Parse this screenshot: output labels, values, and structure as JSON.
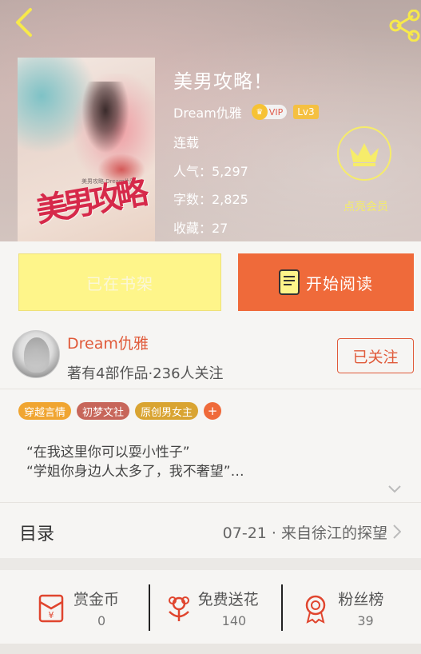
{
  "book": {
    "title": "美男攻略！",
    "author": "Dream仇雅",
    "vip_label": "VIP",
    "level": "Lv3",
    "status": "连载",
    "popularity": "人气：5,297",
    "word_count": "字数：2,825",
    "collections": "收藏：27",
    "cover_title": "美男攻略",
    "cover_subtitle": "美男攻略·Dream仇雅"
  },
  "vip_member": {
    "label": "点亮会员"
  },
  "actions": {
    "shelf_label": "已在书架",
    "read_label": "开始阅读"
  },
  "author_info": {
    "name": "Dream仇雅",
    "stats": "著有4部作品·236人关注",
    "follow_label": "已关注"
  },
  "tags": [
    {
      "label": "穿越言情",
      "color": "#f0a531"
    },
    {
      "label": "初梦文社",
      "color": "#c7665a"
    },
    {
      "label": "原创男女主",
      "color": "#d9a432"
    }
  ],
  "tag_add": "+",
  "description": {
    "line1": "“在我这里你可以耍小性子”",
    "line2": "“学姐你身边人太多了，我不奢望”…"
  },
  "catalog": {
    "label": "目录",
    "latest": "07-21 · 来自徐江的探望"
  },
  "stats": [
    {
      "label": "赏金币",
      "value": "0",
      "icon": "red-envelope-icon"
    },
    {
      "label": "免费送花",
      "value": "140",
      "icon": "flower-icon"
    },
    {
      "label": "粉丝榜",
      "value": "39",
      "icon": "medal-icon"
    }
  ],
  "colors": {
    "accent": "#ef6a3a",
    "shelf_button": "#fef58a",
    "vip_yellow": "#f4ec6a"
  }
}
